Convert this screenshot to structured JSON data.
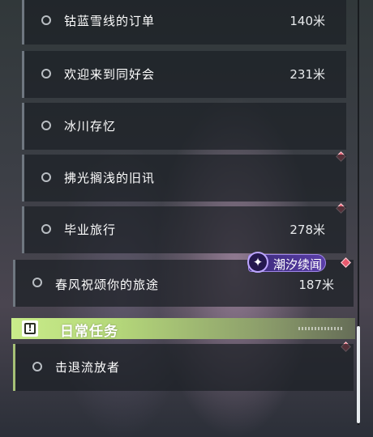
{
  "quests": [
    {
      "title": "钴蓝雪线的订单",
      "distance": "140米"
    },
    {
      "title": "欢迎来到同好会",
      "distance": "231米"
    },
    {
      "title": "冰川存忆",
      "distance": ""
    },
    {
      "title": "拂光搁浅的旧讯",
      "distance": ""
    },
    {
      "title": "毕业旅行",
      "distance": "278米"
    }
  ],
  "event_quest": {
    "title": "春风祝颂你的旅途",
    "distance": "187米",
    "tag_label": "潮汐续闻",
    "tag_icon": "spark-icon"
  },
  "daily_section": {
    "title": "日常任务",
    "icon": "exclamation-square-icon"
  },
  "daily_quests": [
    {
      "title": "击退流放者",
      "distance": ""
    }
  ],
  "colors": {
    "daily_accent": "#c9ec8a",
    "event_tag": "#4a3494",
    "marker": "#e85a6e"
  }
}
